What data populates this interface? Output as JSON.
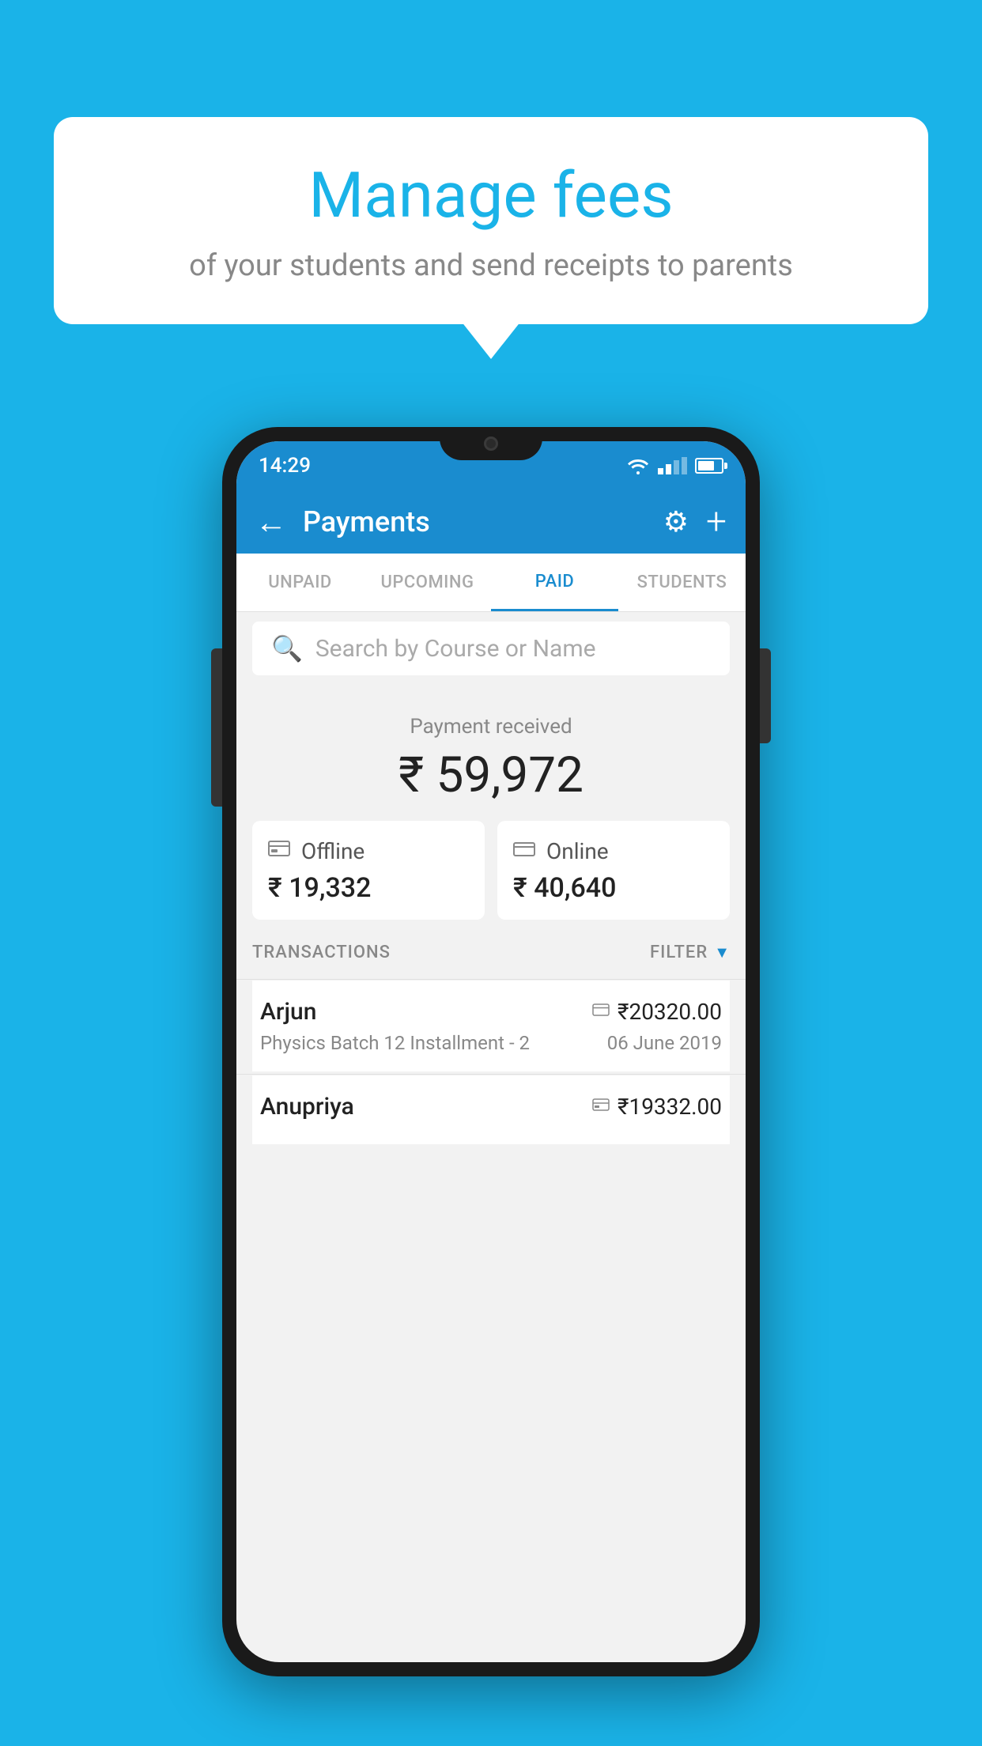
{
  "background_color": "#1ab3e8",
  "bubble": {
    "title": "Manage fees",
    "subtitle": "of your students and send receipts to parents"
  },
  "status_bar": {
    "time": "14:29"
  },
  "toolbar": {
    "title": "Payments",
    "back_icon": "←",
    "gear_icon": "⚙",
    "plus_icon": "+"
  },
  "tabs": [
    {
      "label": "UNPAID",
      "active": false
    },
    {
      "label": "UPCOMING",
      "active": false
    },
    {
      "label": "PAID",
      "active": true
    },
    {
      "label": "STUDENTS",
      "active": false
    }
  ],
  "search": {
    "placeholder": "Search by Course or Name"
  },
  "payment": {
    "label": "Payment received",
    "amount": "₹ 59,972",
    "offline_label": "Offline",
    "offline_amount": "₹ 19,332",
    "online_label": "Online",
    "online_amount": "₹ 40,640"
  },
  "transactions": {
    "section_label": "TRANSACTIONS",
    "filter_label": "FILTER",
    "items": [
      {
        "name": "Arjun",
        "amount": "₹20320.00",
        "course": "Physics Batch 12 Installment - 2",
        "date": "06 June 2019",
        "payment_type": "online"
      },
      {
        "name": "Anupriya",
        "amount": "₹19332.00",
        "course": "",
        "date": "",
        "payment_type": "offline"
      }
    ]
  }
}
